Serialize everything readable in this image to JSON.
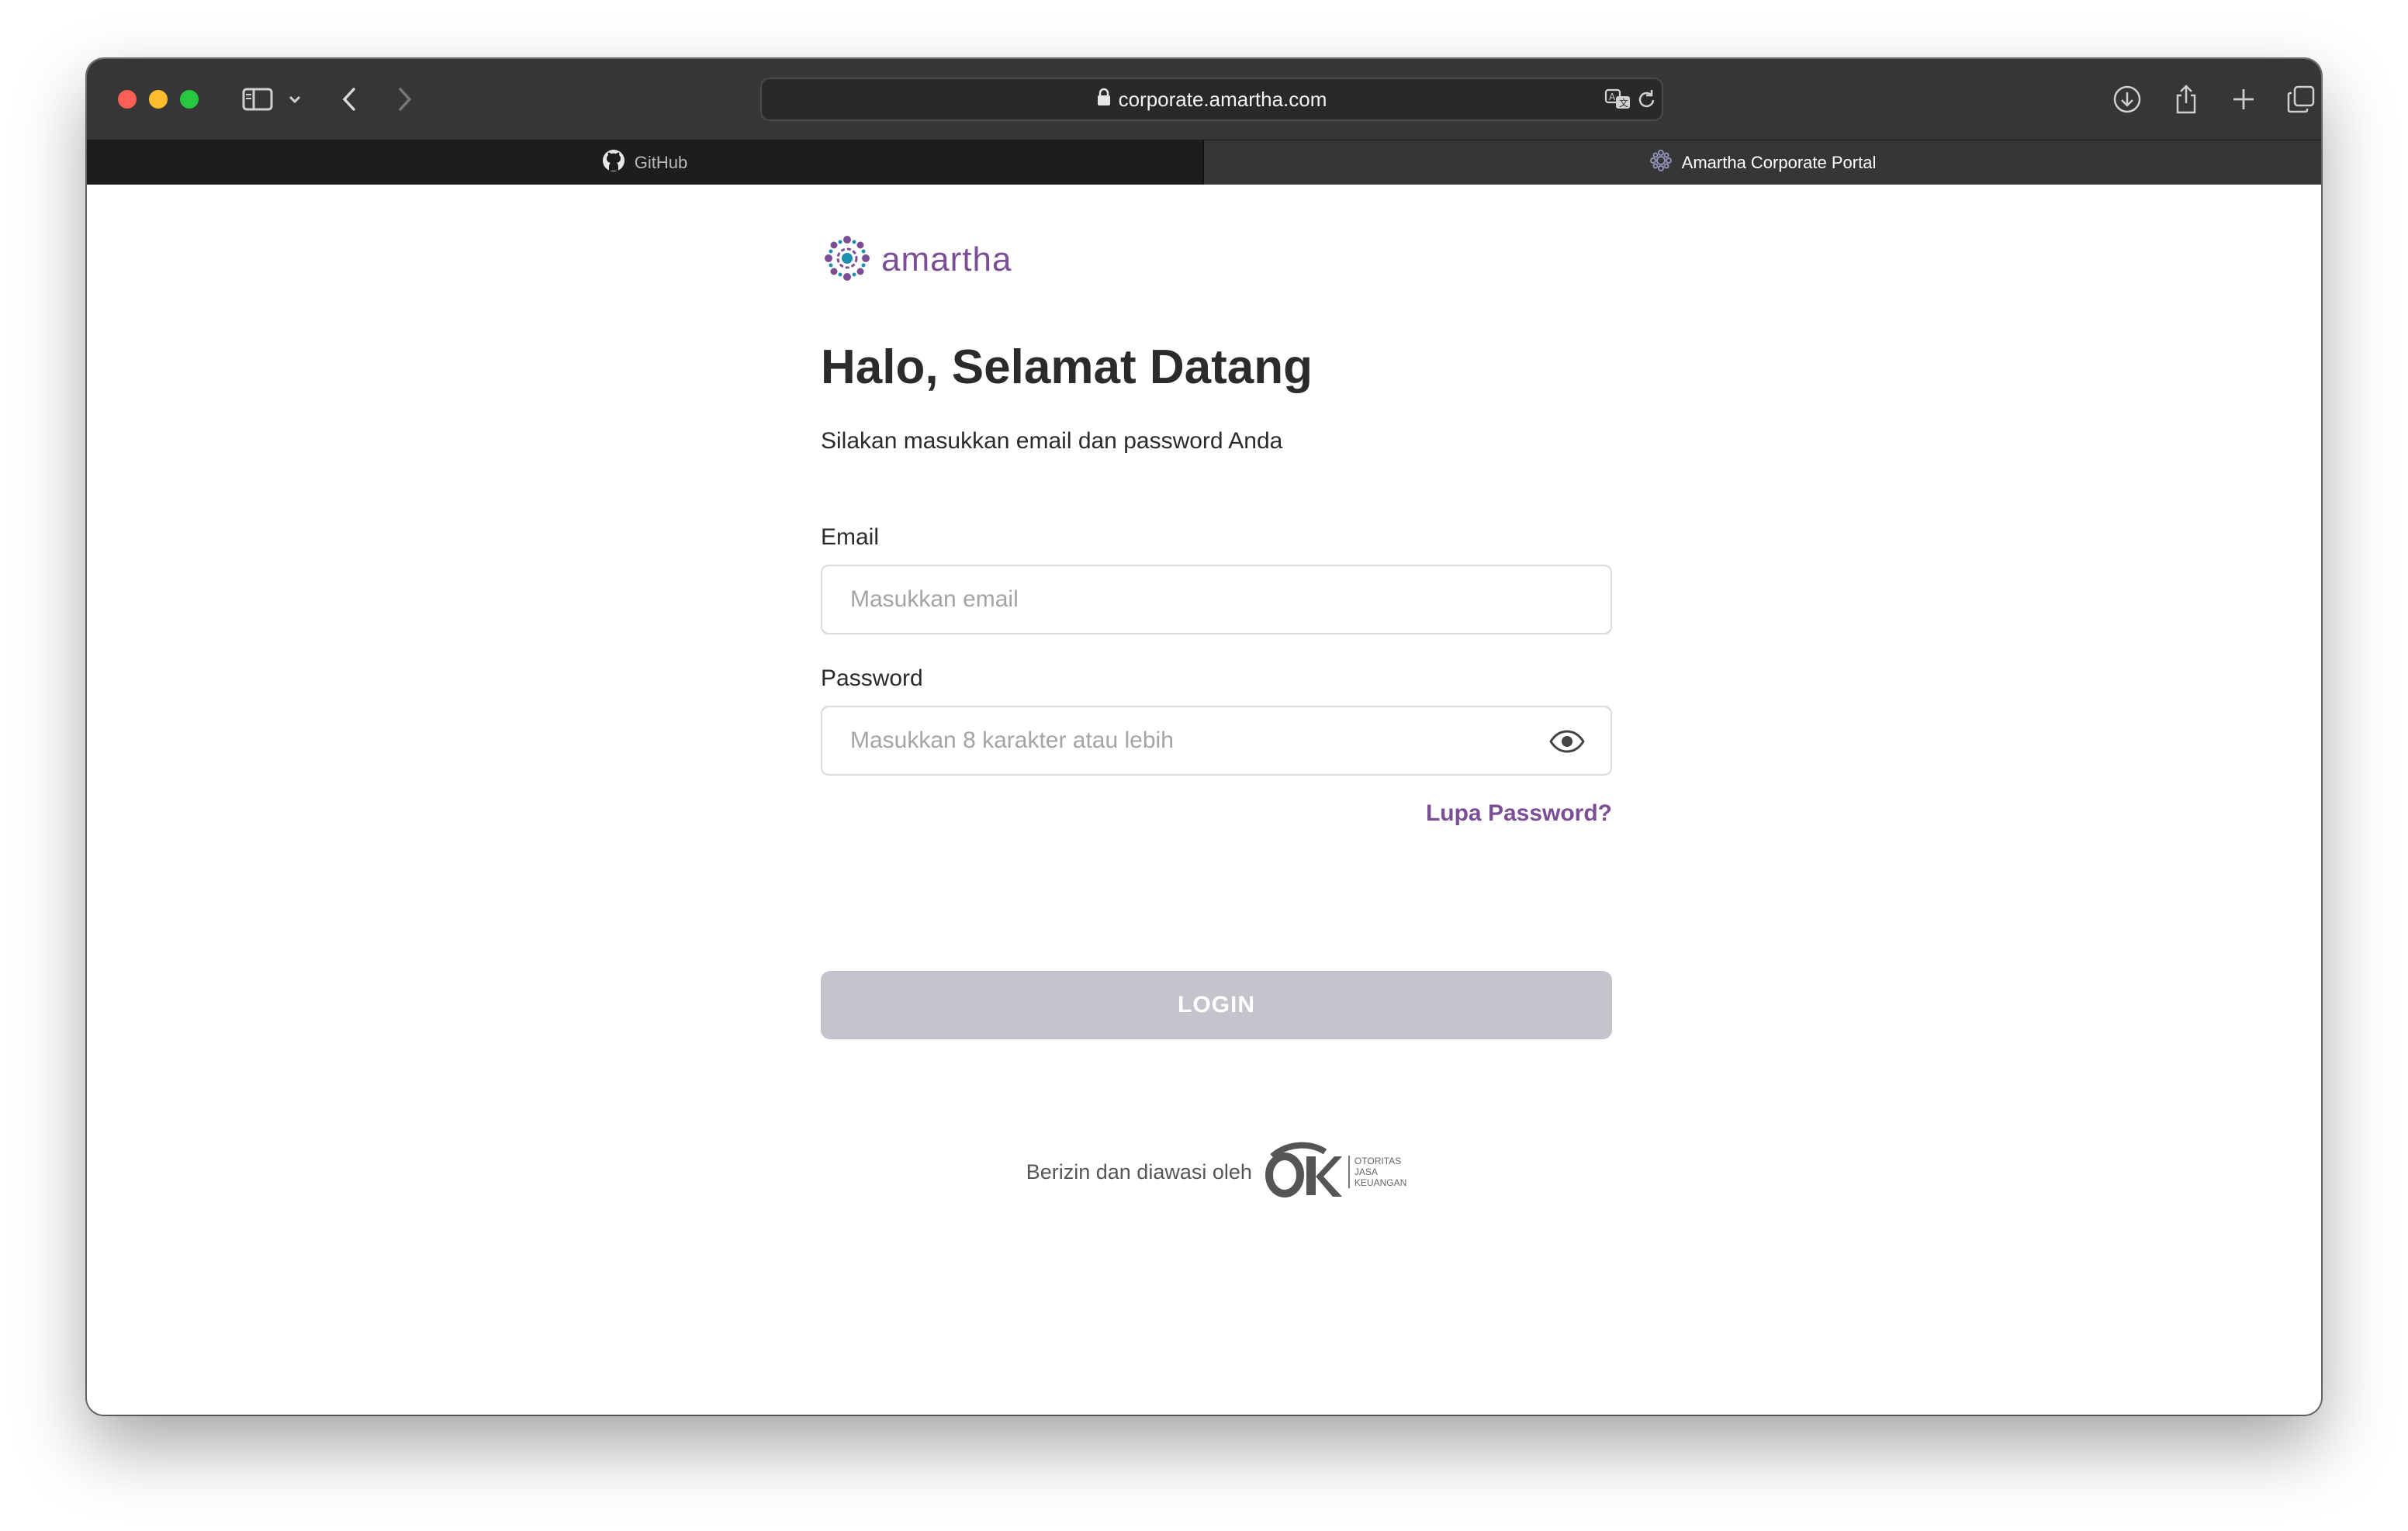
{
  "browser": {
    "url": "corporate.amartha.com",
    "tabs": [
      {
        "label": "GitHub",
        "icon": "github-icon",
        "active": false
      },
      {
        "label": "Amartha Corporate Portal",
        "icon": "amartha-favicon-icon",
        "active": true
      }
    ]
  },
  "brand": {
    "logo_text": "amartha",
    "color": "#7b4e96"
  },
  "login": {
    "title": "Halo, Selamat Datang",
    "subtitle": "Silakan masukkan email dan password Anda",
    "email_label": "Email",
    "email_placeholder": "Masukkan email",
    "email_value": "",
    "password_label": "Password",
    "password_placeholder": "Masukkan 8 karakter atau lebih",
    "password_value": "",
    "forgot_label": "Lupa Password?",
    "login_button": "LOGIN",
    "login_button_color": "#c4c4cc"
  },
  "footer": {
    "regulated_text": "Berizin dan diawasi oleh",
    "ojk_logo_text": "OJK",
    "ojk_lines": [
      "OTORITAS",
      "JASA",
      "KEUANGAN"
    ]
  }
}
